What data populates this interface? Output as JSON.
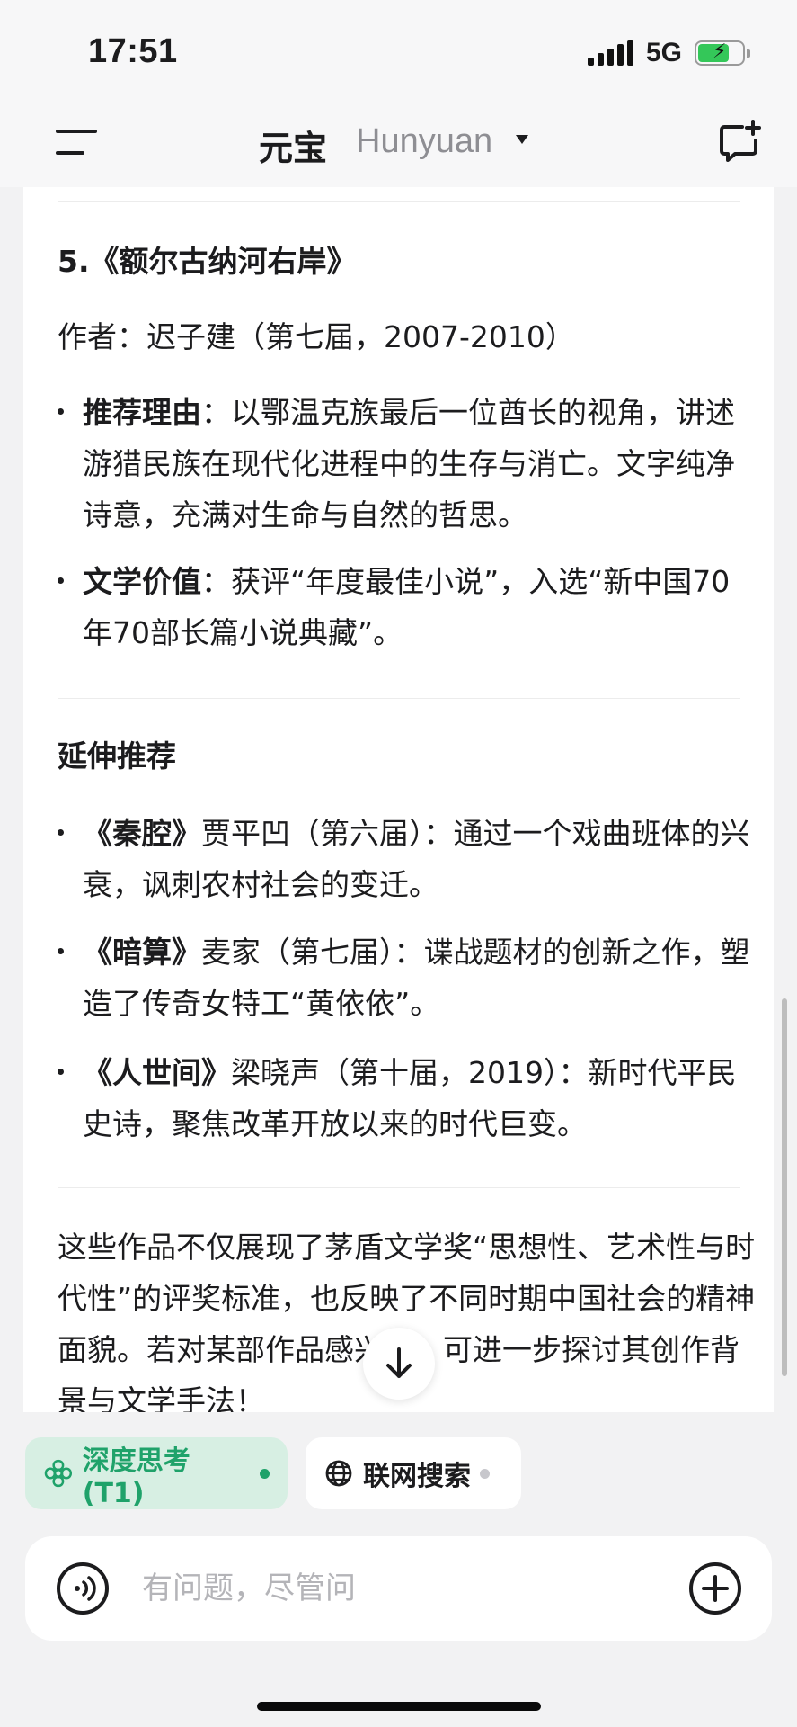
{
  "status_bar": {
    "time": "17:51",
    "network": "5G",
    "battery_icon": "battery-charging-icon",
    "signal_icon": "cellular-signal-icon"
  },
  "nav": {
    "title": "元宝",
    "model": "Hunyuan",
    "menu_icon": "menu-icon",
    "caret_icon": "caret-down-icon",
    "new_chat_icon": "new-chat-icon"
  },
  "article": {
    "book5": {
      "heading": "5.《额尔古纳河右岸》",
      "author": "作者：迟子建（第七届，2007-2010）",
      "reason_label": "推荐理由",
      "reason_text": "：以鄂温克族最后一位酋长的视角，讲述游猎民族在现代化进程中的生存与消亡。文字纯净诗意，充满对生命与自然的哲思。",
      "value_label": "文学价值",
      "value_text": "：获评“年度最佳小说”，入选“新中国70年70部长篇小说典藏”。"
    },
    "extended": {
      "heading": "延伸推荐",
      "items": [
        {
          "title": "《秦腔》",
          "text": "贾平凹（第六届）：通过一个戏曲班体的兴衰，讽刺农村社会的变迁。"
        },
        {
          "title": "《暗算》",
          "text": "麦家（第七届）：谍战题材的创新之作，塑造了传奇女特工“黄依依”。"
        },
        {
          "title": "《人世间》",
          "text": "梁晓声（第十届，2019）：新时代平民史诗，聚焦改革开放以来的时代巨变。"
        }
      ]
    },
    "closing": "这些作品不仅展现了茅盾文学奖“思想性、艺术性与时代性”的评奖标准，也反映了不同时期中国社会的精神面貌。若对某部作品感兴趣，可进一步探讨其创作背景与文学手法！"
  },
  "chips": {
    "deep_think": {
      "label": "深度思考(T1)",
      "active": true,
      "color": "#1fa26a"
    },
    "web_search": {
      "label": "联网搜索",
      "active": false,
      "color": "#c7c7cc"
    }
  },
  "input": {
    "placeholder": "有问题，尽管问",
    "value": ""
  },
  "colors": {
    "accent_green": "#1fa26a",
    "chip_green_bg": "#d7efe3"
  }
}
